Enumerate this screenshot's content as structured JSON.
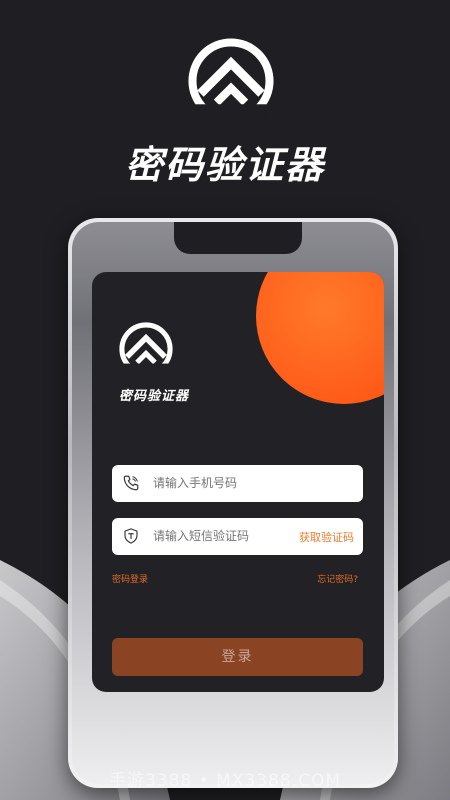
{
  "hero": {
    "title": "密码验证器",
    "logo_icon": "stacked-chevron-logo-icon"
  },
  "app": {
    "name": "密码验证器",
    "logo_icon": "stacked-chevron-logo-icon",
    "accent_color": "#ff6a1f"
  },
  "form": {
    "phone_placeholder": "请输入手机号码",
    "phone_icon": "phone-icon",
    "code_placeholder": "请输入短信验证码",
    "code_icon": "shield-icon",
    "get_code_label": "获取验证码",
    "password_login_label": "密码登录",
    "forgot_password_label": "忘记密码?",
    "login_label": "登录"
  },
  "watermark": {
    "text": "手游3388 • MX3388.COM"
  }
}
